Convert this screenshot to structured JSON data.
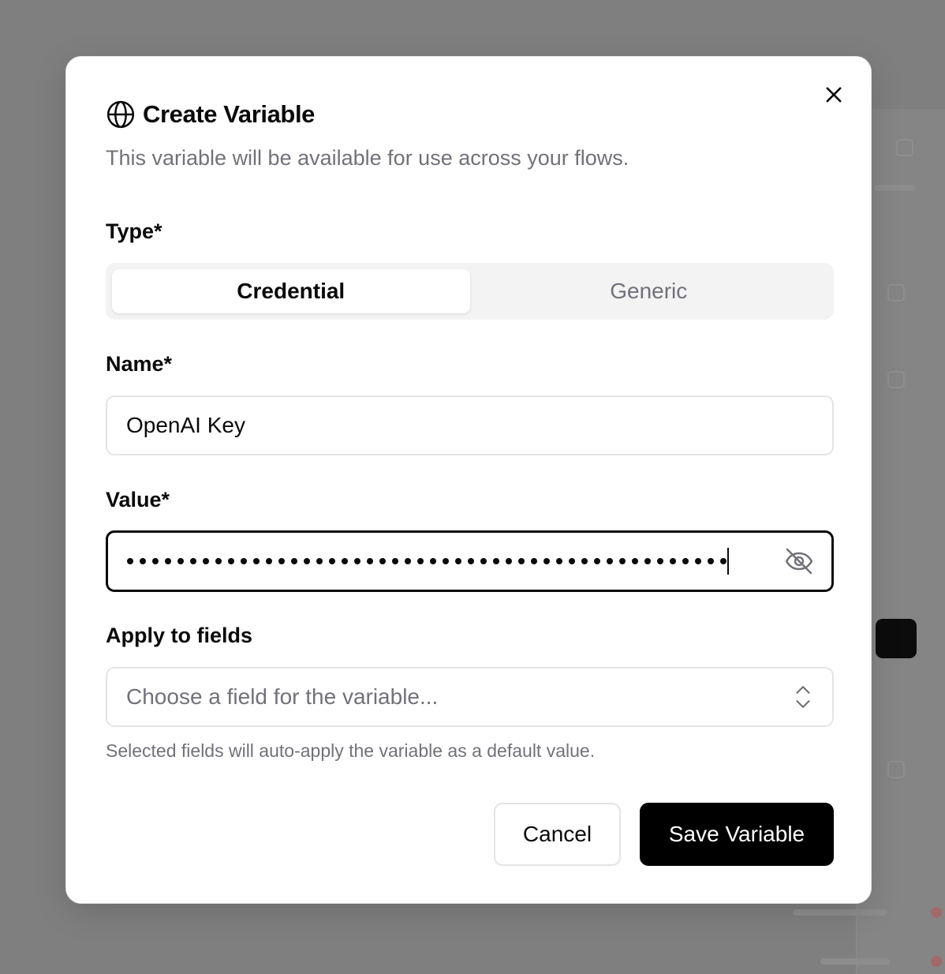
{
  "dialog": {
    "title": "Create Variable",
    "subtitle": "This variable will be available for use across your flows.",
    "title_icon": "globe-icon",
    "close_icon": "close-icon"
  },
  "type_field": {
    "label": "Type*",
    "options": [
      "Credential",
      "Generic"
    ],
    "selected": "Credential"
  },
  "name_field": {
    "label": "Name*",
    "value": "OpenAI Key"
  },
  "value_field": {
    "label": "Value*",
    "masked_length": 48,
    "toggle_icon": "eye-off-icon"
  },
  "apply_field": {
    "label": "Apply to fields",
    "placeholder": "Choose a field for the variable...",
    "helper": "Selected fields will auto-apply the variable as a default value.",
    "icon": "chevrons-up-down-icon"
  },
  "actions": {
    "cancel_label": "Cancel",
    "save_label": "Save Variable"
  },
  "colors": {
    "primary": "#000000",
    "muted_text": "#71717a",
    "border": "#e4e4e7",
    "overlay": "#7f7f7f"
  }
}
